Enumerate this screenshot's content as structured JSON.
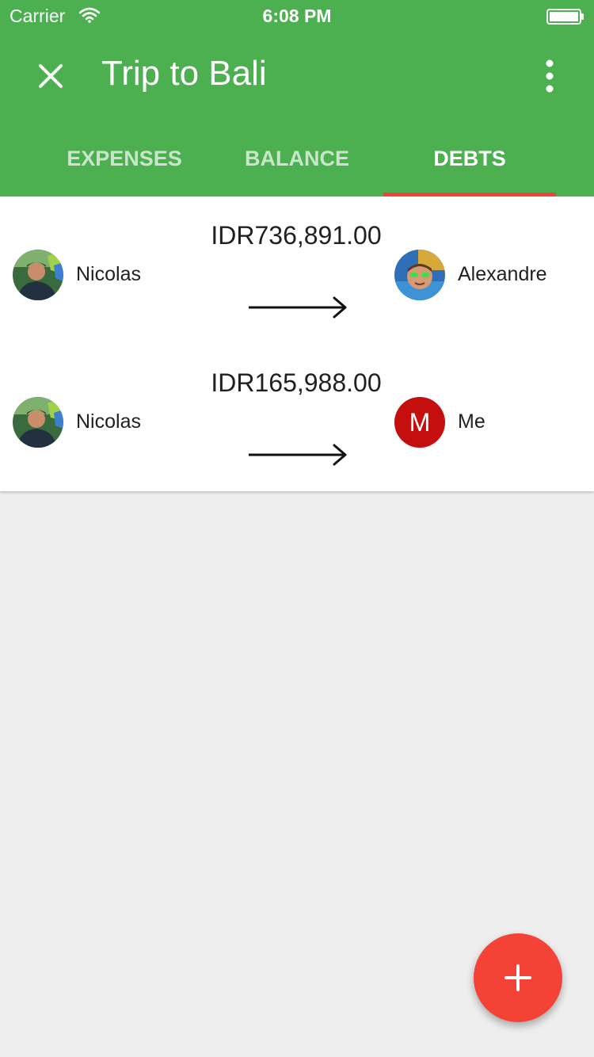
{
  "status_bar": {
    "carrier": "Carrier",
    "time": "6:08 PM"
  },
  "toolbar": {
    "title": "Trip to Bali",
    "close_icon": "close-icon",
    "more_icon": "more-vert-icon"
  },
  "tabs": [
    {
      "label": "EXPENSES",
      "selected": false
    },
    {
      "label": "BALANCE",
      "selected": false
    },
    {
      "label": "DEBTS",
      "selected": true
    }
  ],
  "debts": [
    {
      "from": {
        "name": "Nicolas"
      },
      "amount": "IDR736,891.00",
      "to": {
        "name": "Alexandre"
      }
    },
    {
      "from": {
        "name": "Nicolas"
      },
      "amount": "IDR165,988.00",
      "to": {
        "name": "Me",
        "initial": "M"
      }
    }
  ],
  "fab": {
    "icon": "add-icon"
  },
  "colors": {
    "primary": "#4caf50",
    "accent": "#f44336",
    "avatar_me": "#c50e0e",
    "background": "#eeeeee"
  }
}
